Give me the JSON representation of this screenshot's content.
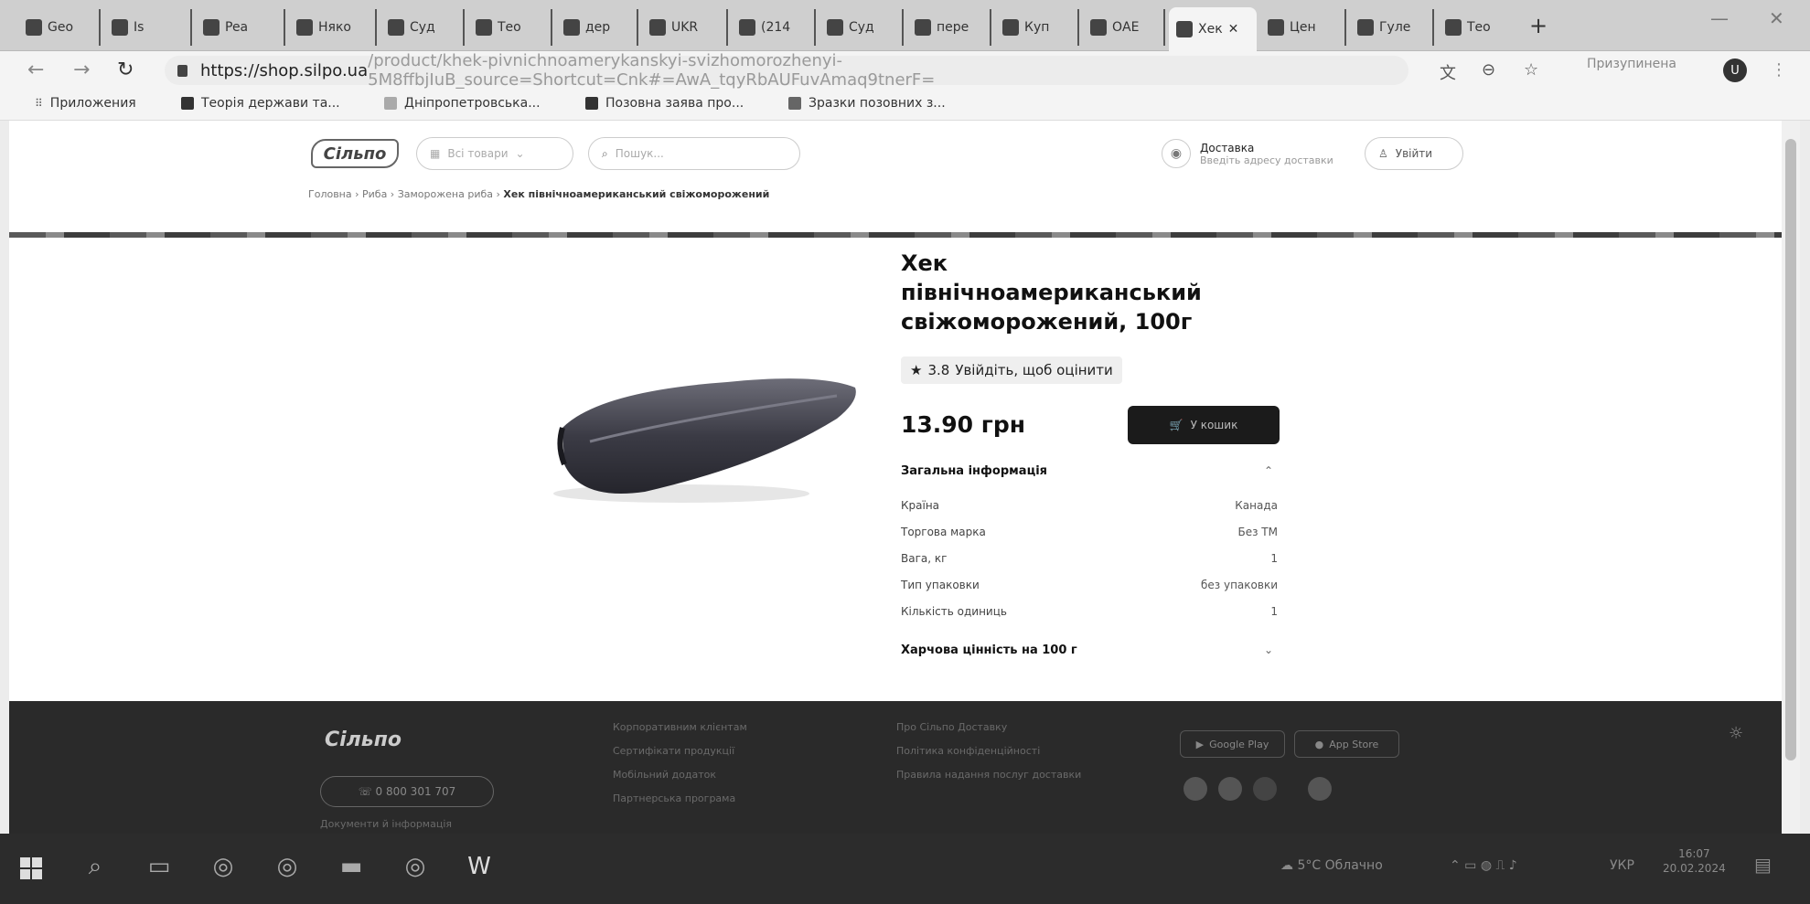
{
  "browser": {
    "tabs": [
      {
        "label": "Geo"
      },
      {
        "label": "Is"
      },
      {
        "label": "Pea"
      },
      {
        "label": "Няко"
      },
      {
        "label": "Суд"
      },
      {
        "label": "Тео"
      },
      {
        "label": "дер"
      },
      {
        "label": "UKR"
      },
      {
        "label": "(214"
      },
      {
        "label": "Суд"
      },
      {
        "label": "пере"
      },
      {
        "label": "Куп"
      },
      {
        "label": "ОАЕ"
      },
      {
        "label": "Хек"
      },
      {
        "label": "Цен"
      },
      {
        "label": "Гуле"
      },
      {
        "label": "Тео"
      }
    ],
    "url_main": "https://shop.silpo.ua",
    "url_rest": "/product/khek-pivnichnoamerykanskyi-svizhomorozhenyi-5M8ffbjIuB_source=Shortcut=Cnk#=AwA_tqyRbAUFuvAmaq9tnerF=",
    "profile_label": "Призупинена",
    "avatar_letter": "U",
    "bookmarks": [
      {
        "label": "Приложения"
      },
      {
        "label": "Теорія держави та..."
      },
      {
        "label": "Дніпропетровська..."
      },
      {
        "label": "Позовна заява про..."
      },
      {
        "label": "Зразки позовних з..."
      }
    ]
  },
  "site": {
    "logo": "Сільпо",
    "catalog_label": "Всі товари",
    "search_placeholder": "Пошук...",
    "delivery_title": "Доставка",
    "delivery_sub": "Введіть адресу доставки",
    "login_label": "Увійти",
    "breadcrumb_start": "Головна › Риба › Заморожена риба ›",
    "breadcrumb_current": "Хек північноамериканський свіжоморожений"
  },
  "product": {
    "title": "Хек північноамериканський свіжоморожений, 100г",
    "rating": "3.8",
    "rate_prompt": "Увійдіть, щоб оцінити",
    "price": "13.90 грн",
    "cart_label": "У кошик",
    "general_info_title": "Загальна інформація",
    "specs": [
      {
        "label": "Країна",
        "value": "Канада"
      },
      {
        "label": "Торгова марка",
        "value": "Без ТМ"
      },
      {
        "label": "Вага, кг",
        "value": "1"
      },
      {
        "label": "Тип упаковки",
        "value": "без упаковки"
      },
      {
        "label": "Кількість одиниць",
        "value": "1"
      }
    ],
    "nutrition_title": "Харчова цінність на 100 г"
  },
  "footer": {
    "logo": "Сільпо",
    "phone": "0 800 301 707",
    "links_col1": [
      "Корпоративним клієнтам",
      "Сертифікати продукції",
      "Мобільний додаток",
      "Партнерська програма"
    ],
    "links_col2": [
      "Про Сільпо Доставку",
      "Політика конфіденційності",
      "Правила надання послуг доставки"
    ],
    "store_google": "Google Play",
    "store_apple": "App Store",
    "misc": "Документи й інформація"
  },
  "taskbar": {
    "weather": "5°C  Облачно",
    "lang": "УКР",
    "time": "16:07",
    "date": "20.02.2024"
  }
}
